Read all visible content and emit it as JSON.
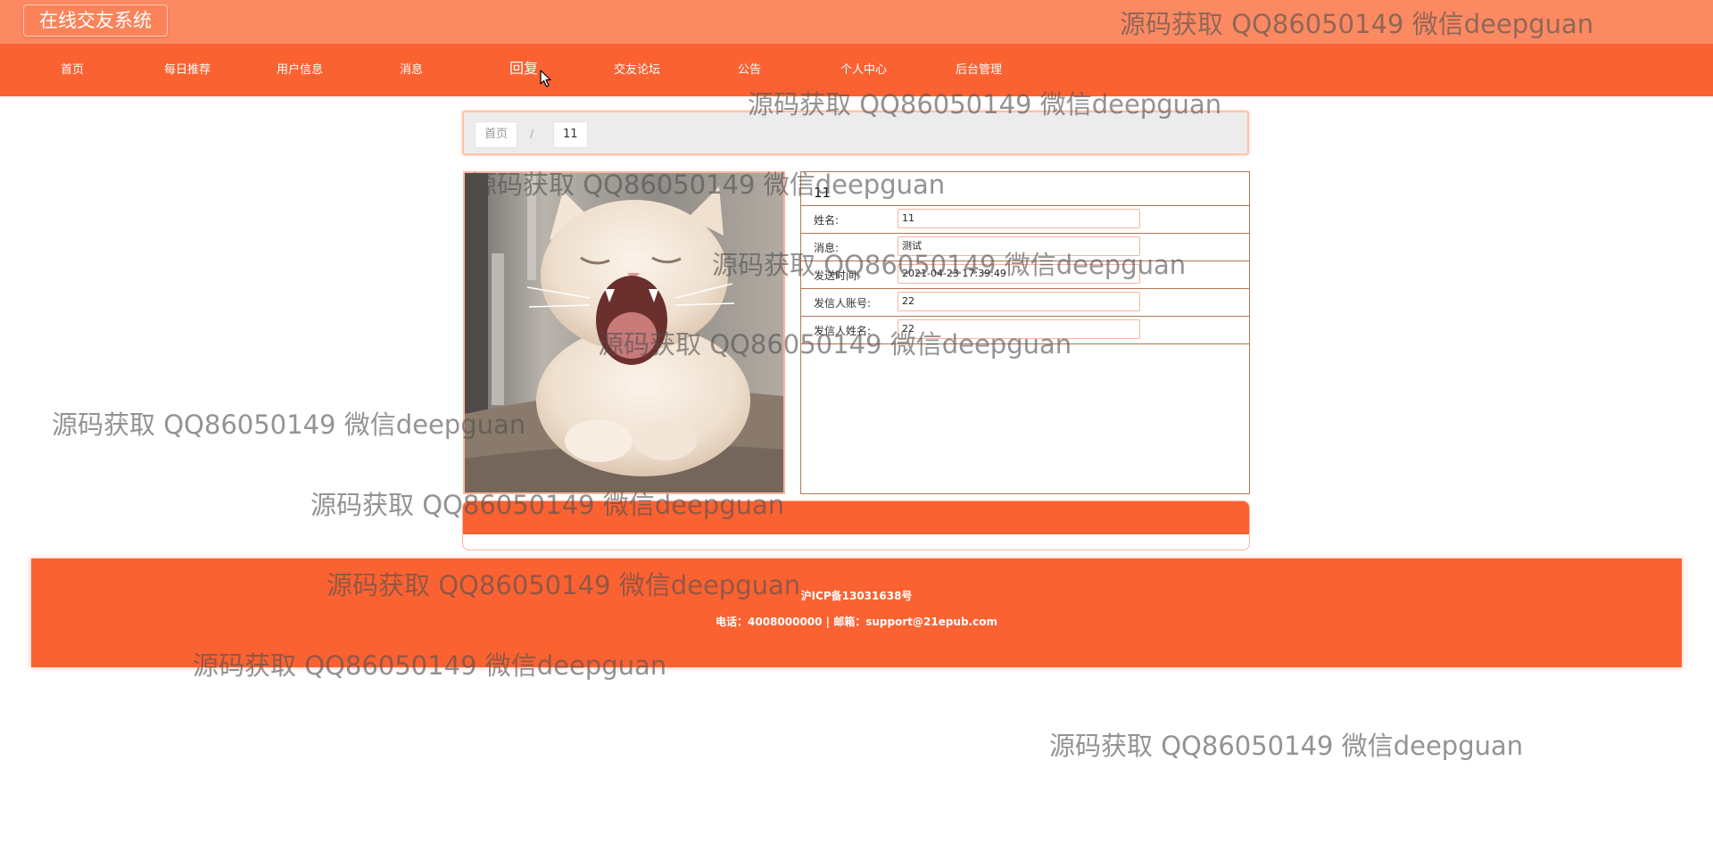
{
  "app": {
    "title": "在线交友系统"
  },
  "nav": {
    "items": [
      {
        "label": "首页"
      },
      {
        "label": "每日推荐"
      },
      {
        "label": "用户信息"
      },
      {
        "label": "消息"
      },
      {
        "label": "回复",
        "active": true
      },
      {
        "label": "交友论坛"
      },
      {
        "label": "公告"
      },
      {
        "label": "个人中心"
      },
      {
        "label": "后台管理"
      }
    ]
  },
  "breadcrumb": {
    "home": "首页",
    "separator": "/",
    "current": "11"
  },
  "detail": {
    "title": "11",
    "fields": [
      {
        "label": "姓名:",
        "value": "11"
      },
      {
        "label": "消息:",
        "value": "测试"
      },
      {
        "label": "发送时间:",
        "value": "2021-04-23 17:39:49"
      },
      {
        "label": "发信人账号:",
        "value": "22"
      },
      {
        "label": "发信人姓名:",
        "value": "22"
      }
    ]
  },
  "footer": {
    "icp": "沪ICP备13031638号",
    "contact": "电话：4008000000 | 邮箱：support@21epub.com"
  },
  "watermark": {
    "text": "源码获取 QQ86050149 微信deepguan"
  },
  "colors": {
    "topbar": "#fb8a62",
    "accent": "#fb6232",
    "border": "#b07554"
  },
  "icons": {
    "cursor": "mouse-pointer-icon"
  }
}
